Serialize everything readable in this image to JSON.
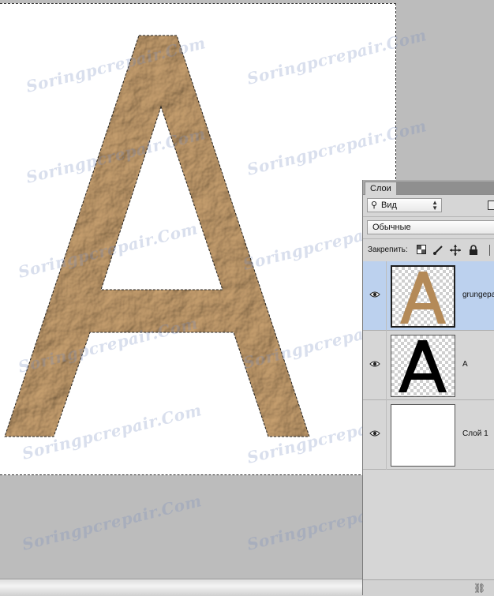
{
  "watermark": "Soringpcrepair.Com",
  "colors": {
    "selection": "#bcd1ee",
    "panel_bg": "#d6d6d6",
    "pasteboard": "#bcbcbc"
  },
  "canvas": {
    "letter": "A"
  },
  "layers_panel": {
    "tab_label": "Слои",
    "filter": {
      "value": "Вид",
      "icon": "search-icon"
    },
    "blend_mode": {
      "value": "Обычные"
    },
    "lock_label": "Закрепить:",
    "lock_icons": [
      "lock-transparent-pixels-icon",
      "lock-image-pixels-icon",
      "lock-position-icon",
      "lock-all-icon"
    ],
    "layers": [
      {
        "name": "grungepa",
        "thumb": "texture-a",
        "selected": true,
        "visible": true
      },
      {
        "name": "A",
        "thumb": "black-a",
        "selected": false,
        "visible": true
      },
      {
        "name": "Слой 1",
        "thumb": "white",
        "selected": false,
        "visible": true
      }
    ],
    "footer_icon": "link-layers-icon"
  }
}
